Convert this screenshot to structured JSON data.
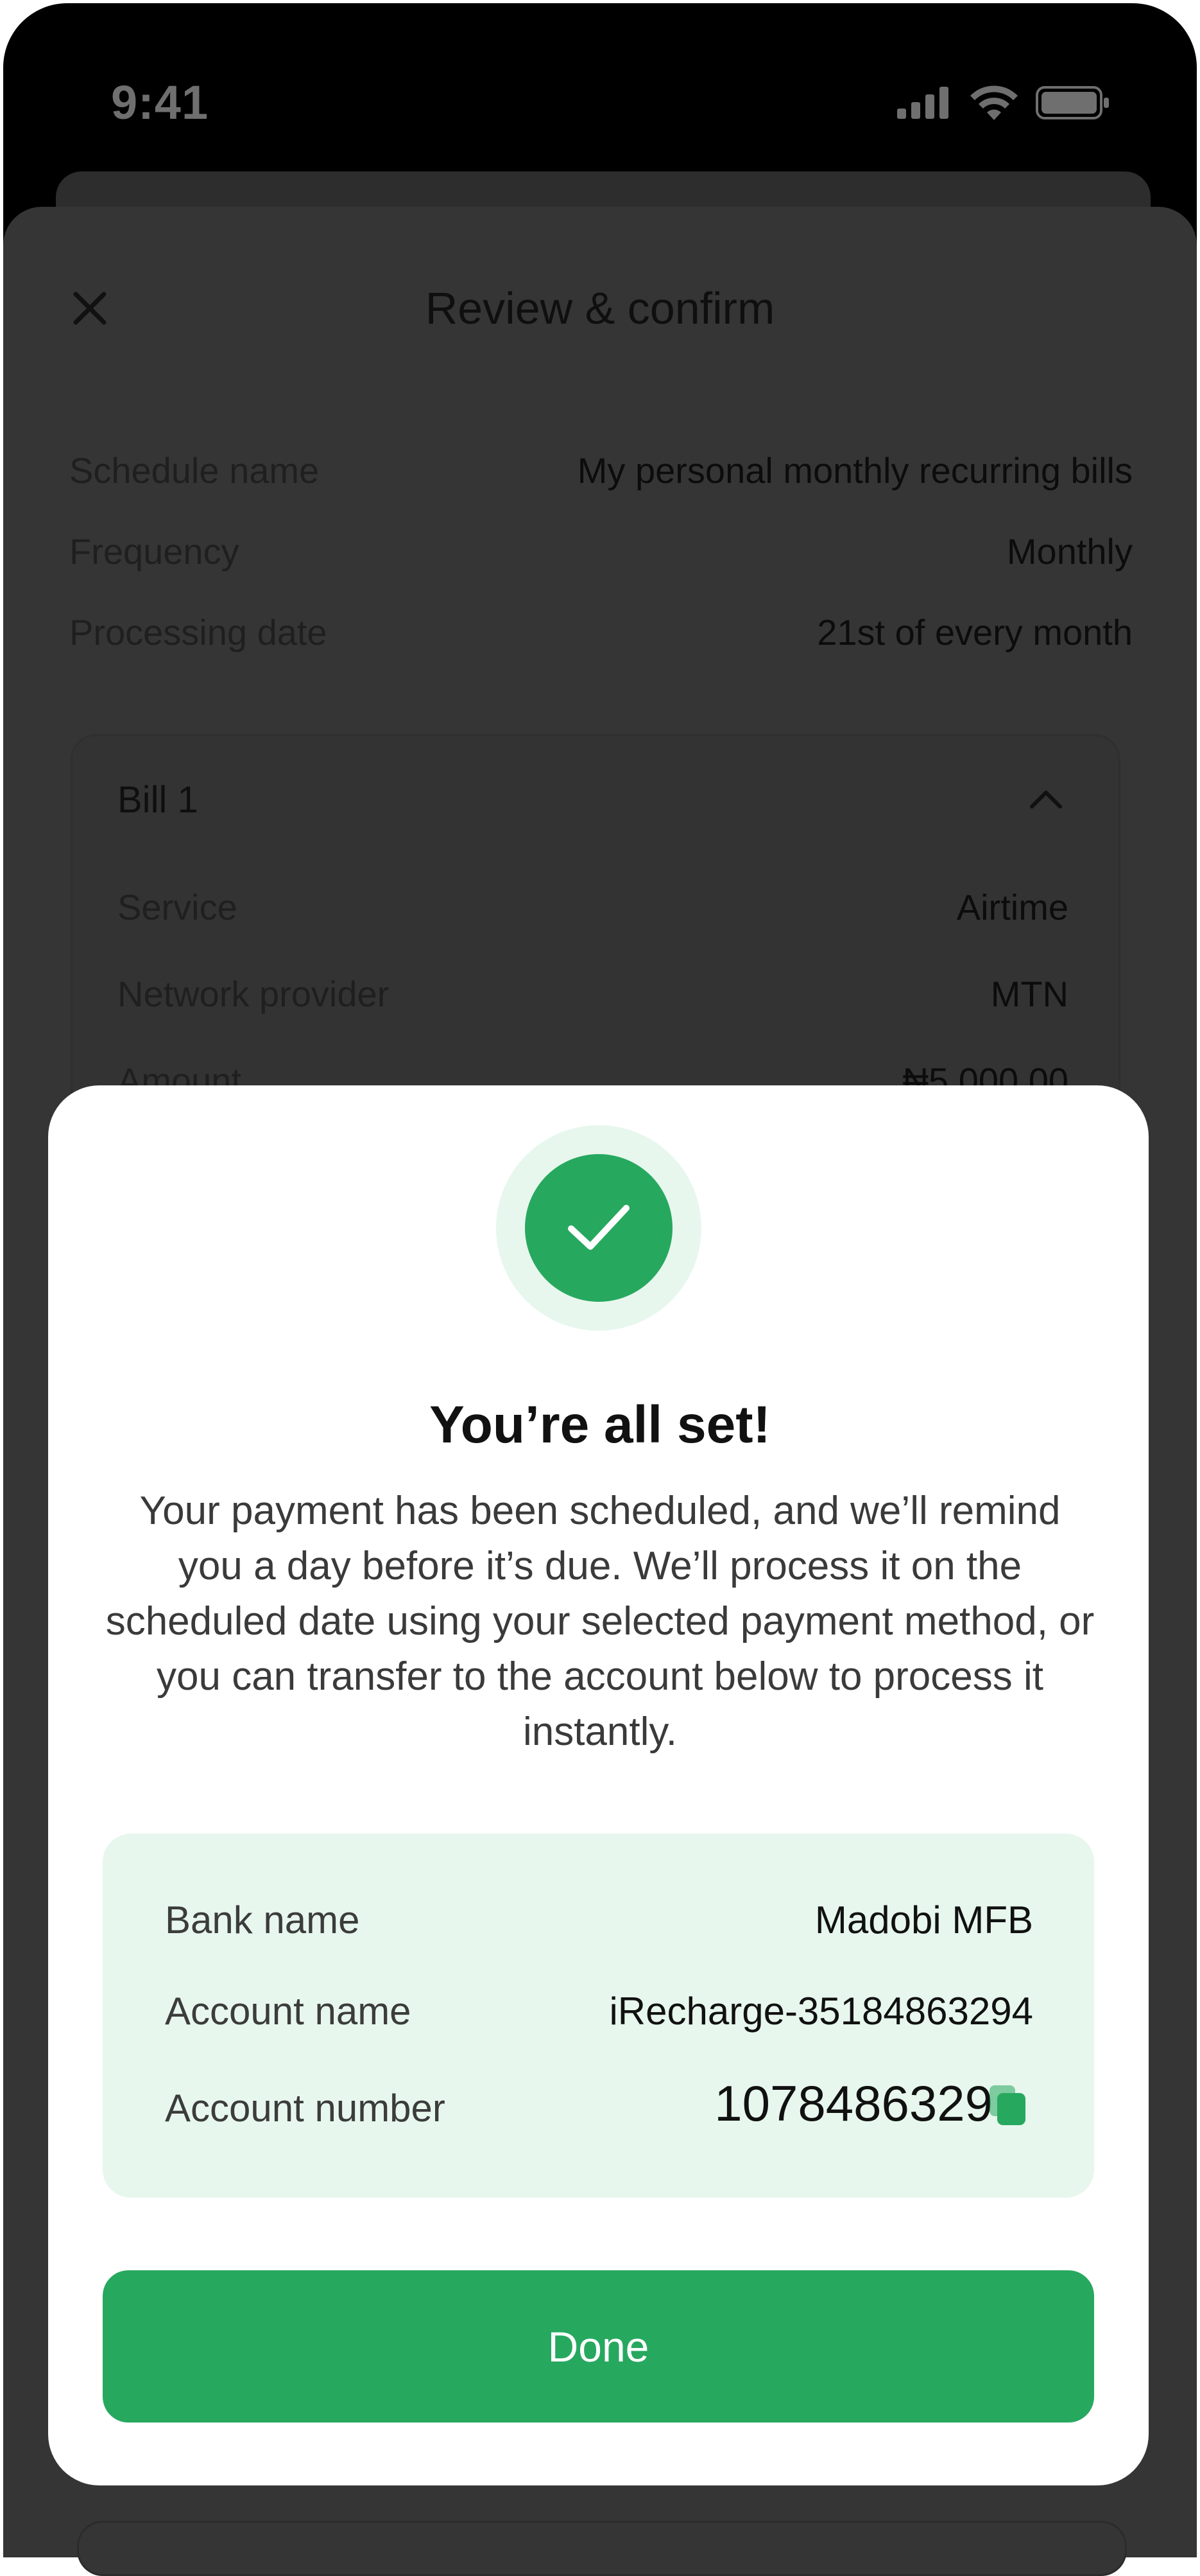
{
  "status_bar": {
    "time": "9:41",
    "icons": [
      "cellular-signal-icon",
      "wifi-icon",
      "battery-icon"
    ]
  },
  "review": {
    "title": "Review & confirm",
    "close_icon": "close-icon",
    "rows": [
      {
        "label": "Schedule name",
        "value": "My personal monthly recurring bills"
      },
      {
        "label": "Frequency",
        "value": "Monthly"
      },
      {
        "label": "Processing date",
        "value": "21st of every month"
      }
    ],
    "bill": {
      "title": "Bill 1",
      "expand_icon": "chevron-up-icon",
      "rows": [
        {
          "label": "Service",
          "value": "Airtime"
        },
        {
          "label": "Network provider",
          "value": "MTN"
        },
        {
          "label": "Amount",
          "value": "₦5,000.00"
        }
      ]
    }
  },
  "modal": {
    "icon": "check-icon",
    "title": "You’re all set!",
    "body": "Your payment has been scheduled, and we’ll remind you a day before it’s due. We’ll process it on the scheduled date using your selected payment method, or you can transfer to the account below to process it instantly.",
    "account": {
      "bank_name_label": "Bank name",
      "bank_name": "Madobi MFB",
      "account_name_label": "Account name",
      "account_name": "iRecharge-35184863294",
      "account_number_label": "Account number",
      "account_number": "1078486329",
      "copy_icon": "copy-icon"
    },
    "done_label": "Done"
  },
  "colors": {
    "accent": "#27a85f",
    "accent_light": "#e7f7ed",
    "overlay": "#353535"
  }
}
